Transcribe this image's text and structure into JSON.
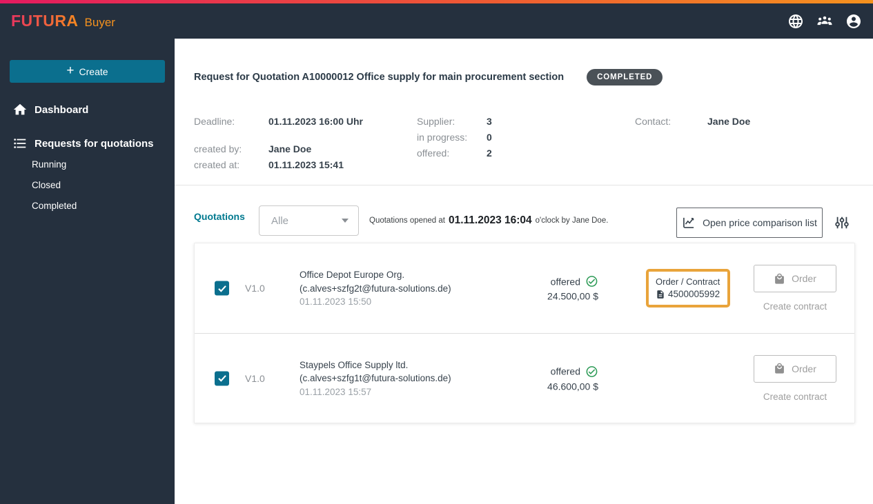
{
  "colors": {
    "header_bg": "#25303e",
    "stripe_gradient_start": "#e41a60",
    "stripe_gradient_end": "#f5921e",
    "accent_teal": "#0b6f8e",
    "brand_orange": "#f5921e",
    "section_teal": "#00798f",
    "highlight_orange": "#e9a43b",
    "status_green": "#2e9b57",
    "badge_bg": "#4a5157"
  },
  "brand": {
    "name": "FUTURA",
    "suffix": "Buyer"
  },
  "sidebar": {
    "create": {
      "icon": "+",
      "label": "Create"
    },
    "items": [
      {
        "label": "Dashboard"
      },
      {
        "label": "Requests for quotations"
      }
    ],
    "sub_items": [
      {
        "label": "Running"
      },
      {
        "label": "Closed"
      },
      {
        "label": "Completed"
      }
    ]
  },
  "main": {
    "title": "Request for Quotation A10000012 Office supply for main procurement section",
    "status_badge": "COMPLETED",
    "details": {
      "deadline_label": "Deadline:",
      "deadline_value": "01.11.2023 16:00 Uhr",
      "created_by_label": "created by:",
      "created_by_value": "Jane Doe",
      "created_at_label": "created at:",
      "created_at_value": "01.11.2023 15:41",
      "supplier_label": "Supplier:",
      "supplier_value": "3",
      "in_progress_label": "in progress:",
      "in_progress_value": "0",
      "offered_label": "offered:",
      "offered_value": "2",
      "contact_label": "Contact:",
      "contact_value": "Jane Doe"
    },
    "quotations": {
      "section_label": "Quotations",
      "filter_value": "Alle",
      "opened_prefix": "Quotations opened at",
      "opened_time": "01.11.2023 16:04",
      "opened_suffix": "o'clock by Jane Doe.",
      "price_comparison_button": "Open price comparison list",
      "rows": [
        {
          "version": "V1.0",
          "supplier": "Office Depot Europe Org.",
          "email": "(c.alves+szfg2t@futura-solutions.de)",
          "date": "01.11.2023 15:50",
          "status": "offered",
          "price": "24.500,00 $",
          "order_contract_label": "Order / Contract",
          "order_contract_number": "4500005992",
          "order_button": "Order",
          "create_contract": "Create contract"
        },
        {
          "version": "V1.0",
          "supplier": "Staypels Office Supply ltd.",
          "email": "(c.alves+szfg1t@futura-solutions.de)",
          "date": "01.11.2023 15:57",
          "status": "offered",
          "price": "46.600,00 $",
          "order_button": "Order",
          "create_contract": "Create contract"
        }
      ]
    }
  }
}
